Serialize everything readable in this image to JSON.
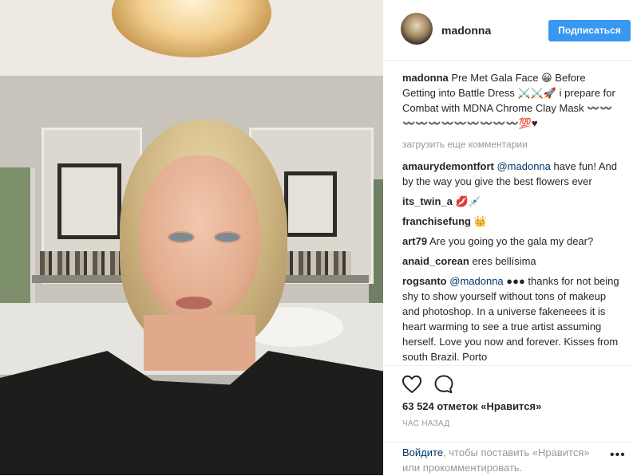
{
  "post": {
    "username": "madonna",
    "follow_label": "Подписаться",
    "caption": {
      "user": "madonna",
      "text": "Pre Met Gala Face 😀 Before Getting into Battle Dress ⚔️⚔️🚀 i prepare for Combat with MDNA Chrome Clay Mask 〰️〰️〰️〰️〰️〰️〰️〰️〰️〰️〰️💯♥"
    },
    "load_more": "загрузить еще комментарии",
    "comments": [
      {
        "user": "amaurydemontfort",
        "mention": "@madonna",
        "text": " have fun! And by the way you give the best flowers ever"
      },
      {
        "user": "its_twin_a",
        "mention": "",
        "text": " 💋💉"
      },
      {
        "user": "franchisefung",
        "mention": "",
        "text": " 👑"
      },
      {
        "user": "art79",
        "mention": "",
        "text": " Are you going yo the gala my dear?"
      },
      {
        "user": "anaid_corean",
        "mention": "",
        "text": " eres bellísima"
      },
      {
        "user": "rogsanto",
        "mention": "@madonna",
        "text": " ●●● thanks for not being shy to show yourself without tons of makeup and photoshop. In a universe fakeneees it is heart warming to see a true artist assuming herself. Love you now and forever. Kisses from south Brazil. Porto"
      }
    ],
    "likes": "63 524 отметок «Нравится»",
    "time_ago": "ЧАС НАЗАД",
    "login_link": "Войдите",
    "login_rest": ", чтобы поставить «Нравится» или прокомментировать.",
    "more_label": "•••"
  },
  "icons": {
    "heart": "heart-icon",
    "comment": "comment-bubble-icon",
    "more": "more-options-icon"
  },
  "colors": {
    "accent": "#3897f0",
    "link": "#003569",
    "muted": "#999999",
    "text": "#262626"
  }
}
